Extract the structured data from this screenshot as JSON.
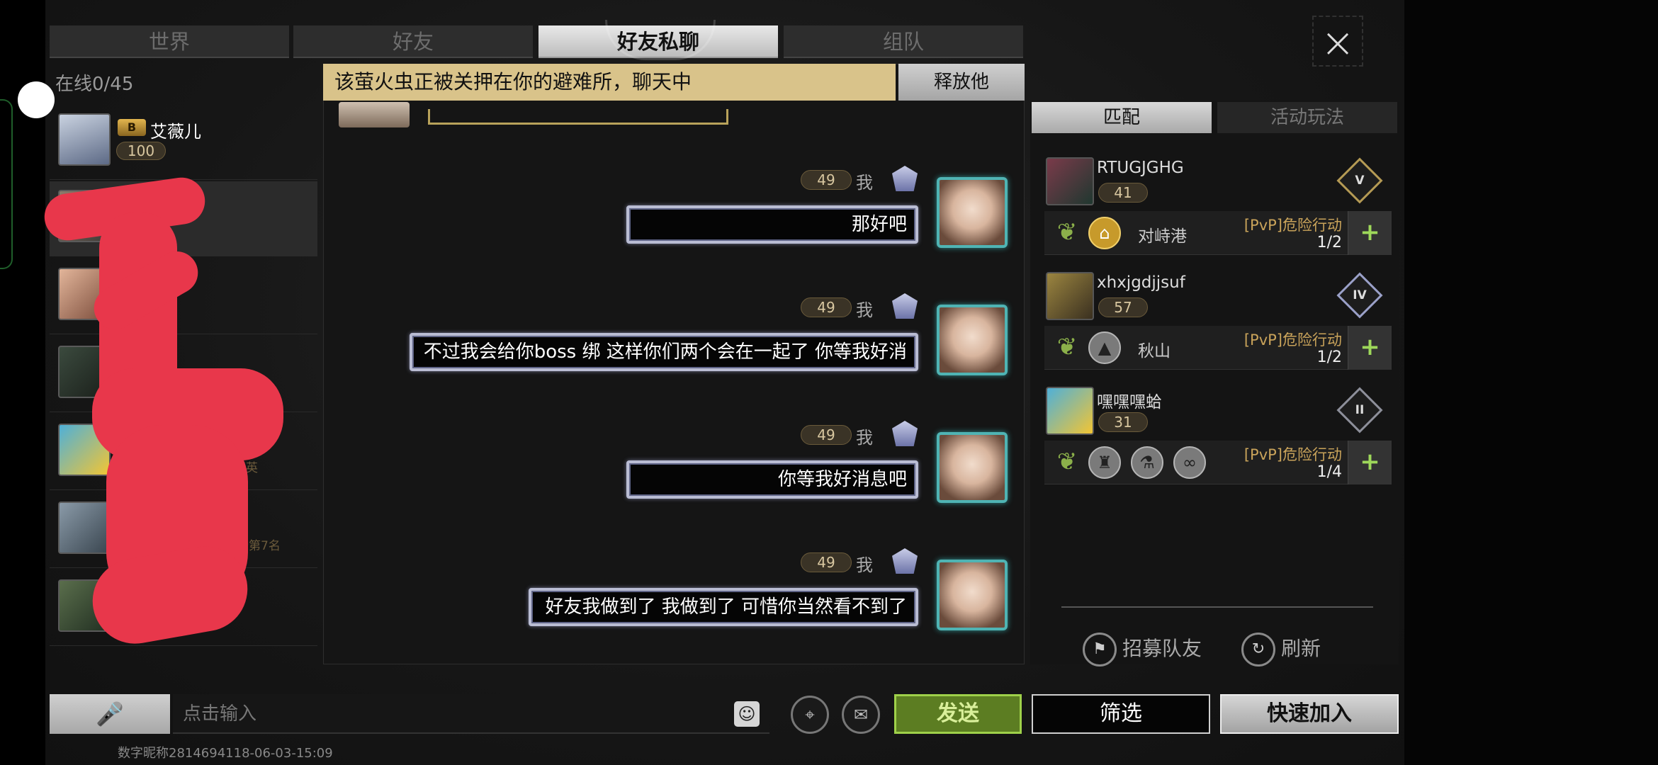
{
  "tabs": [
    "世界",
    "好友",
    "好友私聊",
    "组队"
  ],
  "online_label": "在线0/45",
  "notice": {
    "text": "该萤火虫正被关押在你的避难所，聊天中",
    "release_label": "释放他"
  },
  "friends": [
    {
      "name": "艾薇儿",
      "badge": "B",
      "level": "100",
      "extra": ""
    },
    {
      "name": "",
      "badge": "",
      "level": "",
      "extra": ""
    },
    {
      "name": "",
      "badge": "",
      "level": "",
      "extra": ""
    },
    {
      "name": "",
      "badge": "",
      "level": "",
      "extra": ""
    },
    {
      "name": "",
      "badge": "",
      "level": "",
      "extra": "精英"
    },
    {
      "name": "",
      "badge": "",
      "level": "",
      "extra": "绰虎榜第7名"
    },
    {
      "name": "",
      "badge": "",
      "level": "",
      "extra": ""
    }
  ],
  "messages": [
    {
      "level": "49",
      "sender": "我",
      "text": "那好吧"
    },
    {
      "level": "49",
      "sender": "我",
      "text": "不过我会给你boss 绑 这样你们两个会在一起了 你等我好消"
    },
    {
      "level": "49",
      "sender": "我",
      "text": "你等我好消息吧"
    },
    {
      "level": "49",
      "sender": "我",
      "text": "好友我做到了 我做到了 可惜你当然看不到了"
    }
  ],
  "right_panel": {
    "tabs": [
      "匹配",
      "活动玩法"
    ],
    "teams": [
      {
        "name": "RTUGJGHG",
        "level": "41",
        "rank": "V",
        "map": "对峙港",
        "mode": "[PvP]危险行动",
        "count": "1/2"
      },
      {
        "name": "xhxjgdjjsuf",
        "level": "57",
        "rank": "IV",
        "map": "秋山",
        "mode": "[PvP]危险行动",
        "count": "1/2"
      },
      {
        "name": "嘿嘿嘿蛤",
        "level": "31",
        "rank": "II",
        "map": "",
        "mode": "[PvP]危险行动",
        "count": "1/4"
      }
    ],
    "recruit_label": "招募队友",
    "refresh_label": "刷新"
  },
  "input": {
    "placeholder": "点击输入"
  },
  "buttons": {
    "send": "发送",
    "filter": "筛选",
    "quick_join": "快速加入",
    "close": "×",
    "mic": "🎤",
    "emoji": "☺"
  },
  "watermark": "数字昵称2814694118-06-03-15:09",
  "icons": {
    "close": "close-icon",
    "mic": "mic-icon",
    "emoji": "emoji-icon",
    "radar": "radar-icon",
    "chat": "chat-settings-icon",
    "flag": "flag-icon",
    "refresh": "refresh-icon"
  }
}
